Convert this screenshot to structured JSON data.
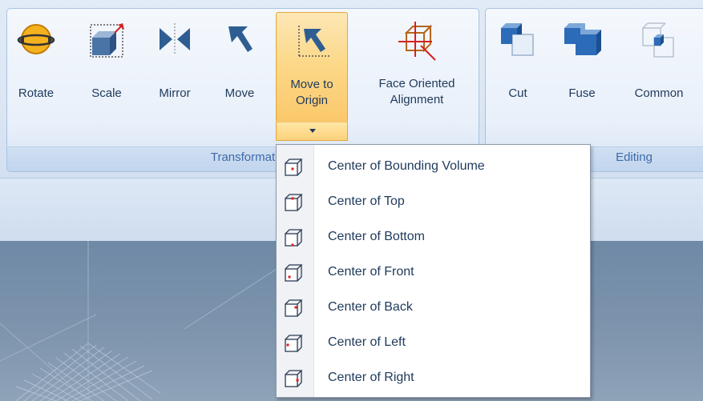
{
  "ribbon": {
    "groups": [
      {
        "caption": "Transformat"
      },
      {
        "caption": "Editing"
      }
    ],
    "tools": [
      {
        "label": "Rotate",
        "icon": "rotate-icon"
      },
      {
        "label": "Scale",
        "icon": "scale-icon"
      },
      {
        "label": "Mirror",
        "icon": "mirror-icon"
      },
      {
        "label": "Move",
        "icon": "move-icon"
      },
      {
        "label": "Move to\nOrigin",
        "icon": "move-to-origin-icon"
      },
      {
        "label": "Face Oriented\nAlignment",
        "icon": "face-oriented-alignment-icon"
      },
      {
        "label": "Cut",
        "icon": "cut-icon"
      },
      {
        "label": "Fuse",
        "icon": "fuse-icon"
      },
      {
        "label": "Common",
        "icon": "common-icon"
      }
    ]
  },
  "menu": {
    "items": [
      {
        "label": "Center of Bounding Volume",
        "icon": "bounding-volume-icon"
      },
      {
        "label": "Center of Top",
        "icon": "top-face-icon"
      },
      {
        "label": "Center of Bottom",
        "icon": "bottom-face-icon"
      },
      {
        "label": "Center of Front",
        "icon": "front-face-icon"
      },
      {
        "label": "Center of Back",
        "icon": "back-face-icon"
      },
      {
        "label": "Center of Left",
        "icon": "left-face-icon"
      },
      {
        "label": "Center of Right",
        "icon": "right-face-icon"
      }
    ]
  },
  "colors": {
    "accent": "#fcd98a",
    "ribbon_text": "#1e395b",
    "caption_text": "#3e6aaa",
    "marker": "#e02020"
  }
}
